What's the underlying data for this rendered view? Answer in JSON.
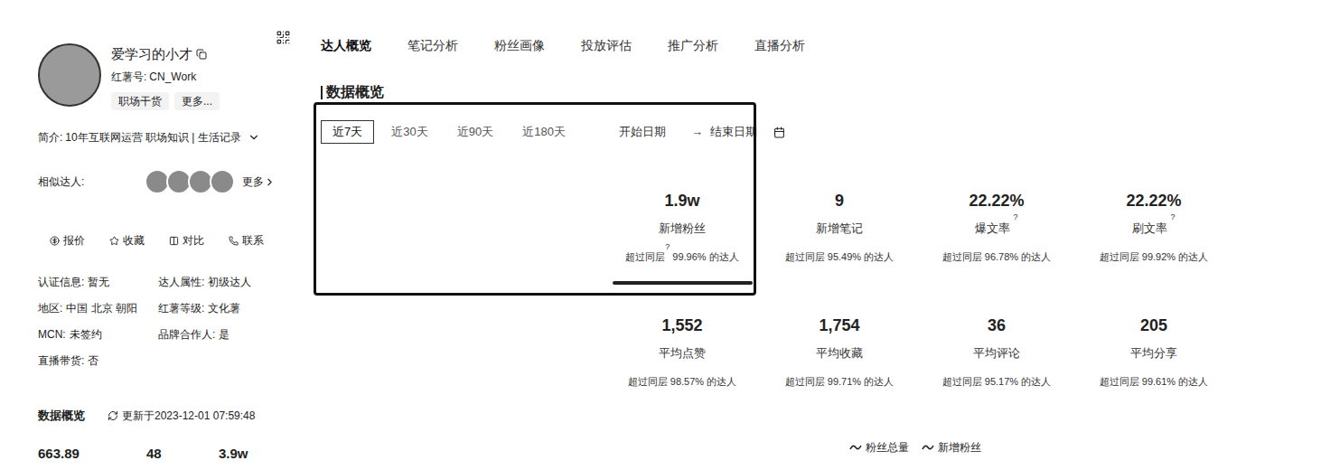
{
  "profile": {
    "name": "爱学习的小才",
    "id_label": "红薯号:",
    "id": "CN_Work",
    "tags": [
      "职场干货",
      "更多..."
    ],
    "intro_label": "简介:",
    "intro": "10年互联网运营 职场知识 | 生活记录",
    "similar_label": "相似达人:",
    "similar_more": "更多",
    "actions": [
      "报价",
      "收藏",
      "对比",
      "联系"
    ],
    "info": [
      {
        "label": "认证信息:",
        "value": "暂无"
      },
      {
        "label": "达人属性:",
        "value": "初级达人"
      },
      {
        "label": "地区:",
        "value": "中国 北京 朝阳"
      },
      {
        "label": "红薯等级:",
        "value": "文化薯"
      },
      {
        "label": "MCN:",
        "value": "未签约"
      },
      {
        "label": "品牌合作人:",
        "value": "是"
      },
      {
        "label": "直播带货:",
        "value": "否"
      }
    ]
  },
  "overview": {
    "title": "数据概览",
    "updated": "更新于2023-12-01 07:59:48",
    "values": [
      "663.89",
      "48",
      "3.9w"
    ]
  },
  "nav": [
    {
      "label": "达人概览",
      "selected": true
    },
    {
      "label": "笔记分析",
      "selected": false
    },
    {
      "label": "粉丝画像",
      "selected": false
    },
    {
      "label": "投放评估",
      "selected": false
    },
    {
      "label": "推广分析",
      "selected": false
    },
    {
      "label": "直播分析",
      "selected": false
    }
  ],
  "section_title": "数据概览",
  "ranges": [
    {
      "label": "近7天",
      "selected": true
    },
    {
      "label": "近30天",
      "selected": false
    },
    {
      "label": "近90天",
      "selected": false
    },
    {
      "label": "近180天",
      "selected": false
    }
  ],
  "date_start": "开始日期",
  "date_arrow": "→",
  "date_end": "结束日期",
  "stats": [
    {
      "value": "1.9w",
      "label": "新增粉丝",
      "compare_prefix": "超过同层",
      "compare_help": "?",
      "compare_value": "99.96% 的达人",
      "selected": true
    },
    {
      "value": "9",
      "label": "新增笔记",
      "compare_prefix": "超过同层",
      "compare_value": "95.49% 的达人",
      "selected": false
    },
    {
      "value": "22.22%",
      "label": "爆文率",
      "label_help": "?",
      "compare_prefix": "超过同层",
      "compare_value": "96.78% 的达人",
      "selected": false
    },
    {
      "value": "22.22%",
      "label": "刷文率",
      "label_help": "?",
      "compare_prefix": "超过同层",
      "compare_value": "99.92% 的达人",
      "selected": false
    },
    {
      "value": "1,552",
      "label": "平均点赞",
      "compare_prefix": "超过同层",
      "compare_value": "98.57% 的达人",
      "selected": false
    },
    {
      "value": "1,754",
      "label": "平均收藏",
      "compare_prefix": "超过同层",
      "compare_value": "99.71% 的达人",
      "selected": false
    },
    {
      "value": "36",
      "label": "平均评论",
      "compare_prefix": "超过同层",
      "compare_value": "95.17% 的达人",
      "selected": false
    },
    {
      "value": "205",
      "label": "平均分享",
      "compare_prefix": "超过同层",
      "compare_value": "99.61% 的达人",
      "selected": false
    }
  ],
  "legend": [
    "粉丝总量",
    "新增粉丝"
  ]
}
